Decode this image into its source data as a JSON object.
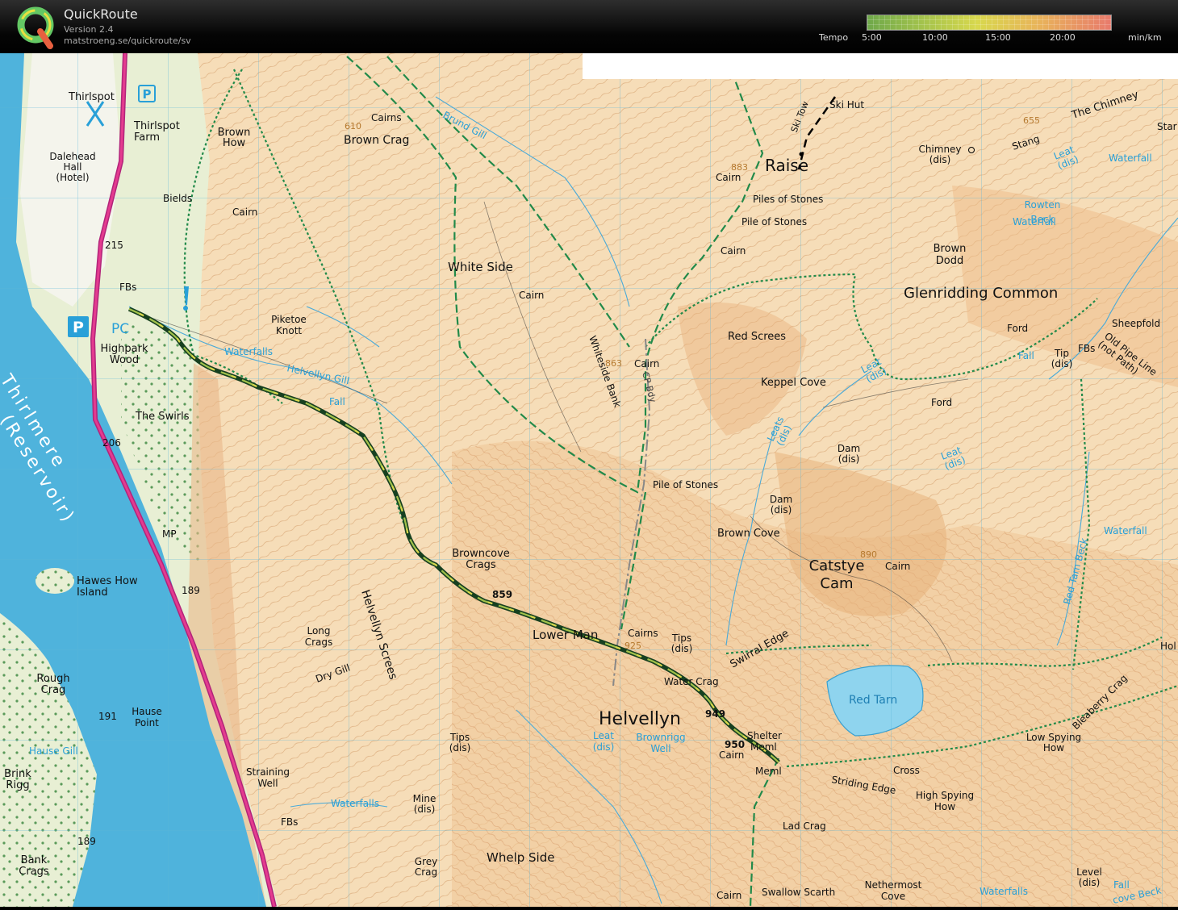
{
  "app": {
    "title": "QuickRoute",
    "version": "Version 2.4",
    "url": "matstroeng.se/quickroute/sv"
  },
  "legend": {
    "label": "Tempo",
    "ticks": [
      "5:00",
      "10:00",
      "15:00",
      "20:00"
    ],
    "unit": "min/km"
  },
  "map": {
    "places": {
      "thirlspot": "Thirlspot",
      "thirlspot_farm": "Thirlspot\nFarm",
      "dalehead_hall": "Dalehead\nHall\n(Hotel)",
      "bields": "Bields",
      "brown_how": "Brown\nHow",
      "brown_crag": "Brown Crag",
      "cairns_1": "Cairns",
      "cairn_1": "Cairn",
      "height_610": "610",
      "height_215": "215",
      "fbs_1": "FBs",
      "pc": "PC",
      "highpark_wood": "Highpark\nWood",
      "piketoe_knott": "Piketoe\nKnott",
      "waterfalls_1": "Waterfalls",
      "helvellyn_gill": "Helvellyn Gill",
      "fall_1": "Fall",
      "the_swirls": "The Swirls",
      "height_206": "206",
      "thirlmere": "Thirlmere",
      "reservoir": "(Reservoir)",
      "hawes_how_island": "Hawes How\nIsland",
      "mp": "MP",
      "height_189a": "189",
      "rough_crag": "Rough\nCrag",
      "height_191": "191",
      "hause_point": "Hause\nPoint",
      "hause_gill": "Hause Gill",
      "brink_rigg": "Brink\nRigg",
      "bank_crags": "Bank\nCrags",
      "height_189b": "189",
      "long_crags": "Long\nCrags",
      "dry_gill": "Dry Gill",
      "helvellyn_screes": "Helvellyn Screes",
      "straining_well": "Straining\nWell",
      "waterfalls_2": "Waterfalls",
      "fbs_2": "FBs",
      "mine": "Mine\n(dis)",
      "grey_crag": "Grey\nCrag",
      "whelp_side": "Whelp Side",
      "tips_1": "Tips\n(dis)",
      "leat_dis_1": "Leat\n(dis)",
      "brownrigg_well": "Brownrigg\nWell",
      "browncove_crags": "Browncove\nCrags",
      "height_859": "859",
      "lower_man": "Lower Man",
      "white_side": "White Side",
      "cairn_2": "Cairn",
      "brund_gill": "Brund Gill",
      "whiteside_bank": "Whiteside Bank",
      "height_863": "863",
      "cairn_3": "Cairn",
      "cp_bdy": "CP Bdy",
      "pile_of_stones_1": "Pile of Stones",
      "cairns_2": "Cairns",
      "height_925": "925",
      "tips_2": "Tips\n(dis)",
      "water_crag": "Water Crag",
      "helvellyn": "Helvellyn",
      "height_949": "949",
      "height_950": "950",
      "cairn_4": "Cairn",
      "shelter": "Shelter",
      "meml_1": "Meml",
      "meml_2": "Meml",
      "swirral_edge": "Swirral Edge",
      "red_tarn": "Red Tarn",
      "raise": "Raise",
      "height_883": "883",
      "cairn_5": "Cairn",
      "piles_of_stones": "Piles of Stones",
      "pile_of_stones_2": "Pile of Stones",
      "cairn_6": "Cairn",
      "ski_tow": "Ski Tow",
      "ski_hut": "Ski Hut",
      "red_screes": "Red Screes",
      "keppel_cove": "Keppel Cove",
      "leat_dis_2": "Leat\n(dis)",
      "leats_dis": "Leats\n(dis)",
      "dam_1": "Dam\n(dis)",
      "dam_2": "Dam\n(dis)",
      "brown_cove": "Brown Cove",
      "catstye_cam": "Catstye\nCam",
      "height_890": "890",
      "cairn_7": "Cairn",
      "chimney": "Chimney\n(dis)",
      "stang": "Stang",
      "the_chimney": "The Chimney",
      "height_655": "655",
      "leat_dis_3": "Leat\n(dis)",
      "waterfall_1": "Waterfall",
      "rowten_beck": "Rowten\nBeck",
      "waterfall_2": "Waterfall",
      "brown_dodd": "Brown\nDodd",
      "glenridding_common": "Glenridding Common",
      "ford_1": "Ford",
      "sheepfold": "Sheepfold",
      "fbs_3": "FBs",
      "tip_dis": "Tip\n(dis)",
      "fall_2": "Fall",
      "old_pipe_line": "Old Pipe Line\n(not Path)",
      "ford_2": "Ford",
      "leat_dis_4": "Leat\n(dis)",
      "waterfall_3": "Waterfall",
      "red_tarn_beck": "Red Tarn Beck",
      "bleaberry_crag": "Bleaberry Crag",
      "low_spying_how": "Low Spying\nHow",
      "cross": "Cross",
      "striding_edge": "Striding Edge",
      "high_spying_how": "High Spying\nHow",
      "lad_crag": "Lad Crag",
      "swallow_scarth": "Swallow Scarth",
      "cairn_8": "Cairn",
      "nethermost_cove": "Nethermost\nCove",
      "level": "Level\n(dis)",
      "fall_3": "Fall",
      "waterfalls_3": "Waterfalls",
      "cove_beck": "cove Beck",
      "star": "Star",
      "hol": "Hol"
    }
  }
}
